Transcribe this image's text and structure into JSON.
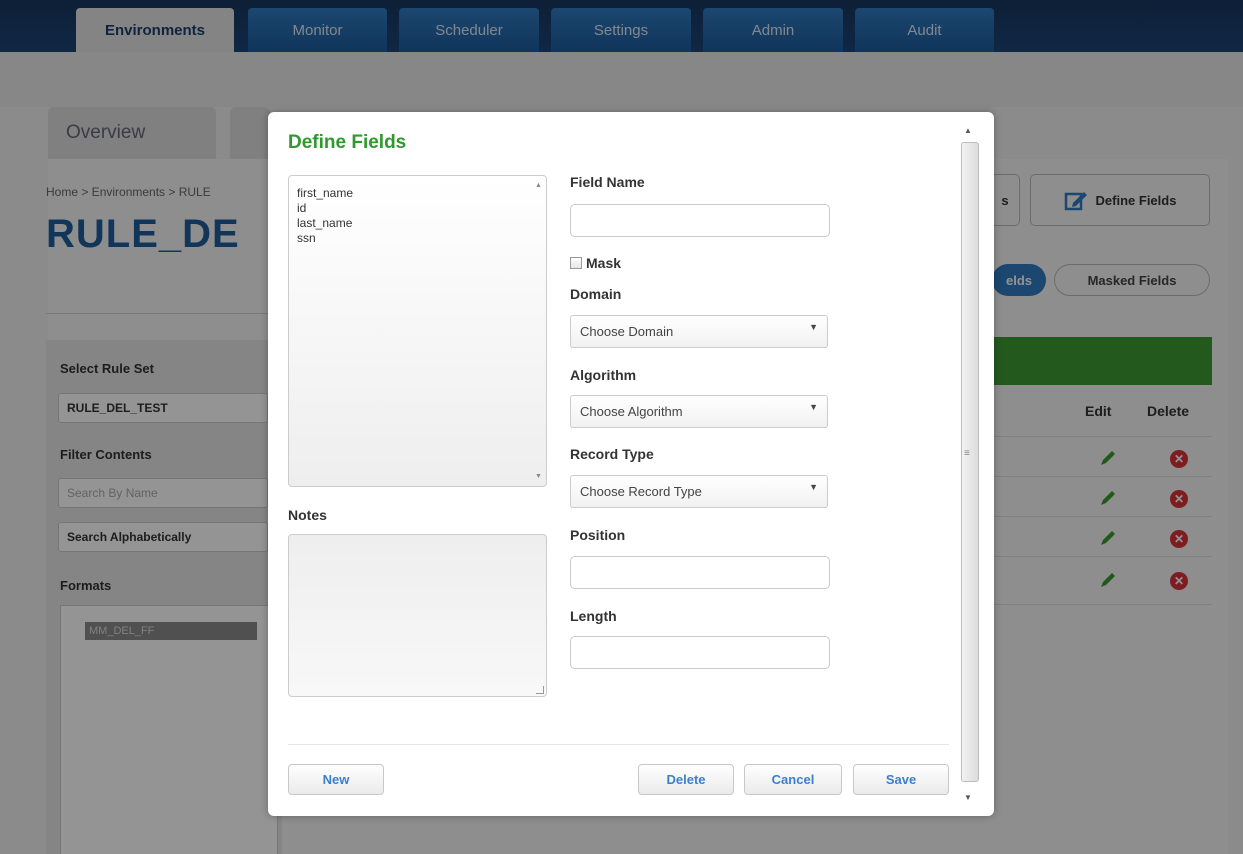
{
  "top_nav": {
    "tabs": [
      "Environments",
      "Monitor",
      "Scheduler",
      "Settings",
      "Admin",
      "Audit"
    ],
    "active": "Environments"
  },
  "sub_nav": {
    "overview": "Overview"
  },
  "page": {
    "breadcrumb": "Home > Environments > RULE",
    "title": "RULE_DE",
    "left": {
      "select_rule_set_label": "Select Rule Set",
      "rule_set_value": "RULE_DEL_TEST",
      "filter_label": "Filter Contents",
      "search_placeholder": "Search By Name",
      "sort_value": "Search Alphabetically",
      "formats_label": "Formats",
      "format_item": "MM_DEL_FF"
    },
    "right": {
      "partial_button": "s",
      "define_fields_button": "Define Fields",
      "fields_pill": "elds",
      "masked_fields_pill": "Masked Fields",
      "edit_header": "Edit",
      "delete_header": "Delete",
      "row_count": 4
    }
  },
  "modal": {
    "title": "Define Fields",
    "field_list": [
      "first_name",
      "id",
      "last_name",
      "ssn"
    ],
    "notes_label": "Notes",
    "field_name_label": "Field Name",
    "mask_label": "Mask",
    "domain_label": "Domain",
    "domain_value": "Choose Domain",
    "algorithm_label": "Algorithm",
    "algorithm_value": "Choose Algorithm",
    "record_type_label": "Record Type",
    "record_type_value": "Choose Record Type",
    "position_label": "Position",
    "length_label": "Length",
    "buttons": {
      "new": "New",
      "delete": "Delete",
      "cancel": "Cancel",
      "save": "Save"
    }
  },
  "colors": {
    "accent_green": "#2e9a2e",
    "button_blue": "#3b7fd1",
    "nav_blue": "#1e5a9b",
    "delete_red": "#d9333a"
  }
}
